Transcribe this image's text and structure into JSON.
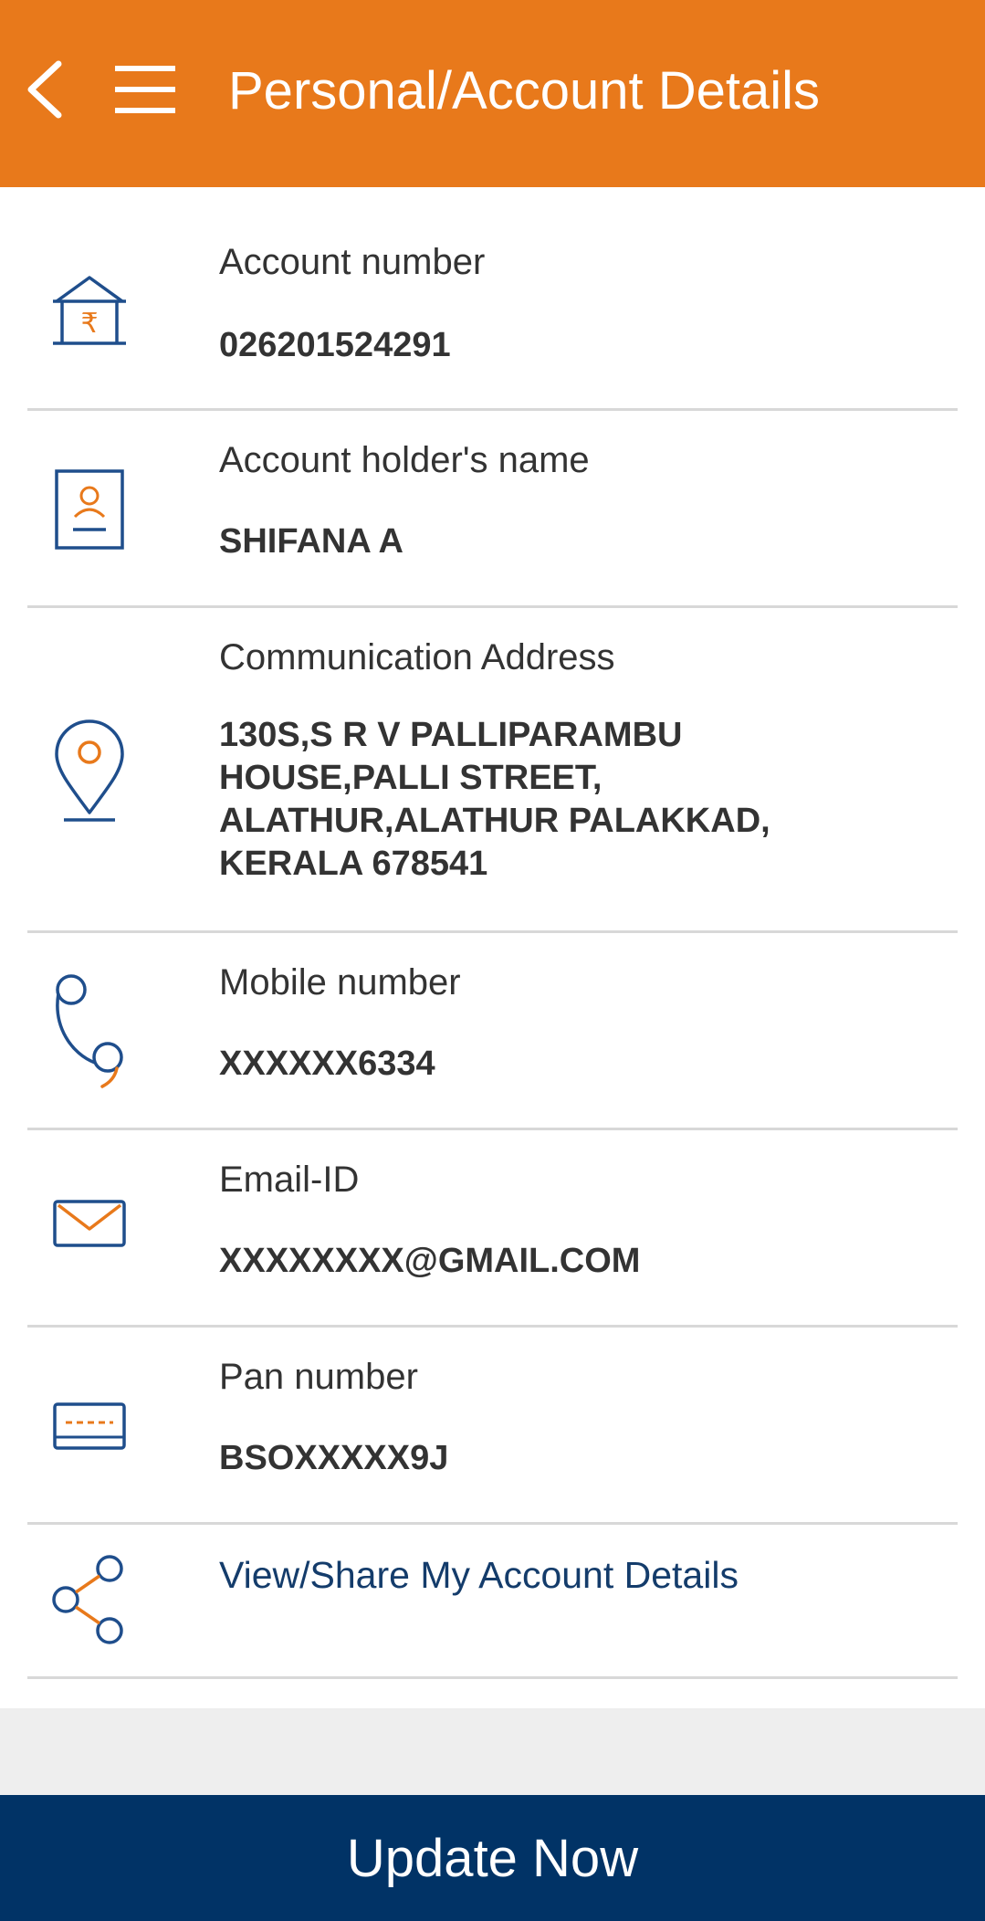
{
  "header": {
    "title": "Personal/Account Details",
    "back_icon": "chevron-left-icon",
    "menu_icon": "hamburger-menu-icon"
  },
  "details": [
    {
      "label": "Account number",
      "value": "026201524291",
      "icon": "bank-rupee-icon"
    },
    {
      "label": "Account holder's name",
      "value": "SHIFANA A",
      "icon": "id-card-icon"
    },
    {
      "label": "Communication Address",
      "value_lines": [
        "130S,S R V PALLIPARAMBU",
        "HOUSE,PALLI STREET,",
        "ALATHUR,ALATHUR PALAKKAD,",
        "KERALA 678541"
      ],
      "icon": "location-pin-icon"
    },
    {
      "label": "Mobile number",
      "value": "XXXXXX6334",
      "icon": "phone-icon"
    },
    {
      "label": "Email-ID",
      "value": "XXXXXXXX@GMAIL.COM",
      "icon": "envelope-icon"
    },
    {
      "label": "Pan number",
      "value": "BSOXXXXX9J",
      "icon": "card-icon"
    }
  ],
  "share": {
    "label": "View/Share My Account Details",
    "icon": "share-icon"
  },
  "footer": {
    "button_label": "Update Now"
  },
  "colors": {
    "header": "#E8791B",
    "icon_blue": "#1F4E8C",
    "icon_orange": "#E8791B",
    "link": "#143C6B",
    "button": "#013366"
  }
}
